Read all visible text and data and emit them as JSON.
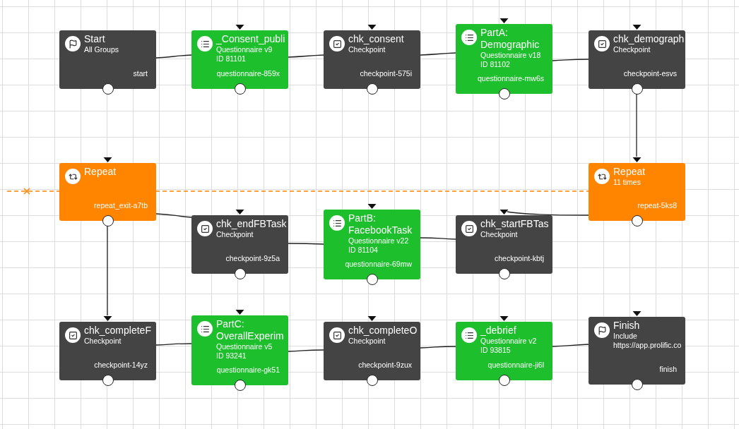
{
  "nodes": [
    {
      "kind": "start",
      "title": "Start",
      "details": [
        "All Groups"
      ],
      "ref": "start"
    },
    {
      "kind": "questionnaire",
      "title": "_Consent_publi",
      "details": [
        "Questionnaire v9",
        "ID 81101"
      ],
      "ref": "questionnaire-859x"
    },
    {
      "kind": "checkpoint",
      "title": "chk_consent",
      "details": [
        "Checkpoint"
      ],
      "ref": "checkpoint-575i"
    },
    {
      "kind": "questionnaire",
      "title": "PartA: Demographic",
      "details": [
        "Questionnaire v18",
        "ID 81102"
      ],
      "ref": "questionnaire-mw6s"
    },
    {
      "kind": "checkpoint",
      "title": "chk_demograph",
      "details": [
        "Checkpoint"
      ],
      "ref": "checkpoint-esvs"
    },
    {
      "kind": "repeat",
      "title": "Repeat",
      "ref": "repeat_exit-a7tb"
    },
    {
      "kind": "checkpoint",
      "title": "chk_endFBTask",
      "details": [
        "Checkpoint"
      ],
      "ref": "checkpoint-9z5a"
    },
    {
      "kind": "questionnaire",
      "title": "PartB: FacebookTask",
      "details": [
        "Questionnaire v22",
        "ID 81104"
      ],
      "ref": "questionnaire-69mw"
    },
    {
      "kind": "checkpoint",
      "title": "chk_startFBTas",
      "details": [
        "Checkpoint"
      ],
      "ref": "checkpoint-kbtj"
    },
    {
      "kind": "repeat",
      "title": "Repeat",
      "details": [
        "11 times"
      ],
      "ref": "repeat-5ks8"
    },
    {
      "kind": "checkpoint",
      "title": "chk_completeF",
      "details": [
        "Checkpoint"
      ],
      "ref": "checkpoint-14yz"
    },
    {
      "kind": "questionnaire",
      "title": "PartC: OverallExperim",
      "details": [
        "Questionnaire v5",
        "ID 93241"
      ],
      "ref": "questionnaire-gk51"
    },
    {
      "kind": "checkpoint",
      "title": "chk_completeO",
      "details": [
        "Checkpoint"
      ],
      "ref": "checkpoint-9zux"
    },
    {
      "kind": "questionnaire",
      "title": "_debrief",
      "details": [
        "Questionnaire v2",
        "ID 93815"
      ],
      "ref": "questionnaire-ji6l"
    },
    {
      "kind": "finish",
      "title": "Finish",
      "details": [
        "Include",
        "https://app.prolific.co"
      ],
      "ref": "finish"
    }
  ]
}
